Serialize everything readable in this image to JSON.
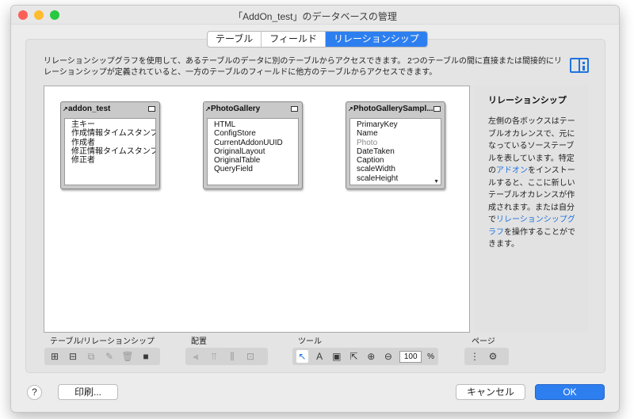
{
  "window": {
    "title": "「AddOn_test」のデータベースの管理",
    "traffic_colors": [
      "#fd5f57",
      "#febc2e",
      "#28c840"
    ]
  },
  "tabs": [
    {
      "label": "テーブル",
      "active": false
    },
    {
      "label": "フィールド",
      "active": false
    },
    {
      "label": "リレーションシップ",
      "active": true
    }
  ],
  "description": {
    "line1": "リレーションシップグラフを使用して、あるテーブルのデータに別のテーブルからアクセスできます。 2つのテーブルの間に直接または間接的にリ",
    "line2": "レーションシップが定義されていると、一方のテーブルのフィールドに他方のテーブルからアクセスできます。"
  },
  "graph": {
    "tables": [
      {
        "name": "addon_test",
        "fields": [
          "主キー",
          "作成情報タイムスタンプ",
          "作成者",
          "修正情報タイムスタンプ",
          "修正者"
        ]
      },
      {
        "name": "PhotoGallery",
        "fields": [
          "HTML",
          "ConfigStore",
          "CurrentAddonUUID",
          "OriginalLayout",
          "OriginalTable",
          "QueryField"
        ]
      },
      {
        "name": "PhotoGallerySampl...",
        "fields": [
          "PrimaryKey",
          "Name",
          "Photo",
          "DateTaken",
          "Caption",
          "scaleWidth",
          "scaleHeight"
        ]
      }
    ]
  },
  "side_panel": {
    "title": "リレーションシップ",
    "p1": "左側の各ボックスはテーブルオカレンスで、元になっているソーステーブルを表しています。特定の",
    "link1": "アドオン",
    "p2": "をインストールすると、ここに新しいテーブルオカレンスが作成されます。または自分で",
    "link2": "リレーションシップグラフ",
    "p3": "を操作することができます。"
  },
  "toolbar": {
    "group_tables_label": "テーブル/リレーションシップ",
    "group_arrange_label": "配置",
    "group_tools_label": "ツール",
    "group_page_label": "ページ",
    "zoom_value": "100",
    "zoom_unit": "%"
  },
  "footer": {
    "help_label": "?",
    "print_label": "印刷...",
    "cancel_label": "キャンセル",
    "ok_label": "OK"
  },
  "accent_color": "#2d7ff0"
}
